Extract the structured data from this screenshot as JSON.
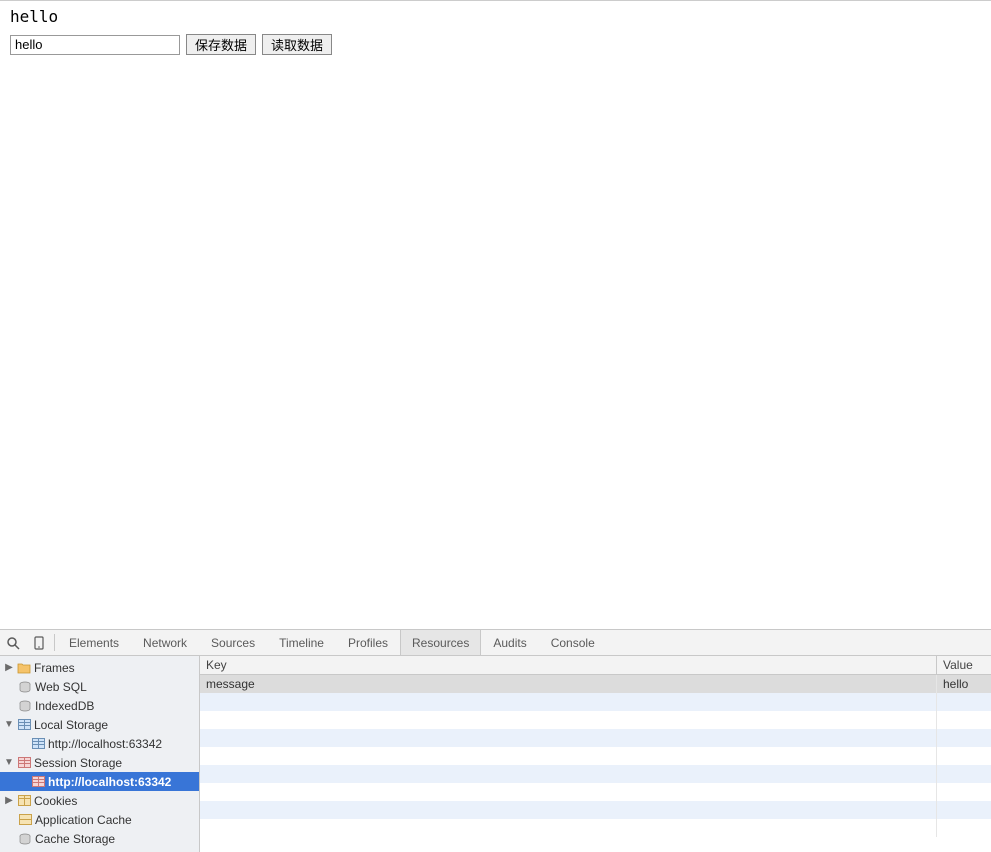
{
  "page": {
    "heading": "hello",
    "input_value": "hello",
    "save_button": "保存数据",
    "read_button": "读取数据"
  },
  "devtools": {
    "tabs": [
      {
        "label": "Elements",
        "active": false
      },
      {
        "label": "Network",
        "active": false
      },
      {
        "label": "Sources",
        "active": false
      },
      {
        "label": "Timeline",
        "active": false
      },
      {
        "label": "Profiles",
        "active": false
      },
      {
        "label": "Resources",
        "active": true
      },
      {
        "label": "Audits",
        "active": false
      },
      {
        "label": "Console",
        "active": false
      }
    ],
    "tree": {
      "frames": "Frames",
      "web_sql": "Web SQL",
      "indexeddb": "IndexedDB",
      "local_storage": "Local Storage",
      "local_storage_url": "http://localhost:63342",
      "session_storage": "Session Storage",
      "session_storage_url": "http://localhost:63342",
      "cookies": "Cookies",
      "app_cache": "Application Cache",
      "cache_storage": "Cache Storage"
    },
    "table": {
      "header_key": "Key",
      "header_value": "Value",
      "rows": [
        {
          "key": "message",
          "value": "hello"
        }
      ],
      "blank_rows": 8
    }
  }
}
